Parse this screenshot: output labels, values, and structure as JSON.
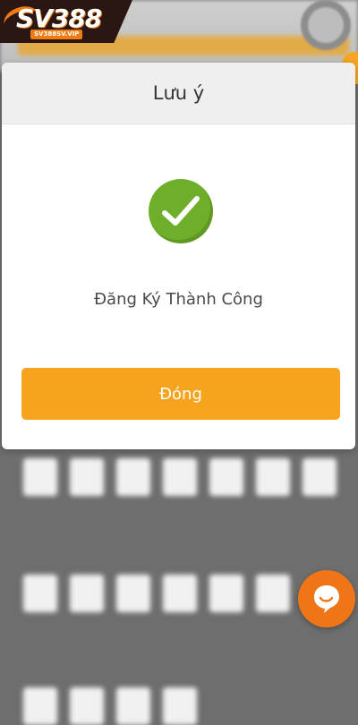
{
  "brand": {
    "logo_text": "SV388",
    "logo_subtext": "SV388SV.VIP",
    "accent_color": "#f07b12"
  },
  "modal": {
    "title": "Lưu ý",
    "status_icon": "checkmark-circle-icon",
    "status_color": "#6fae2a",
    "message": "Đăng Ký Thành Công",
    "close_button_label": "Đóng",
    "button_color": "#f6a31e"
  },
  "chat": {
    "icon": "chat-bubble-icon",
    "color": "#f07516"
  },
  "edge_tab": {
    "icon": "chevron-right-icon",
    "glyph": "›"
  }
}
